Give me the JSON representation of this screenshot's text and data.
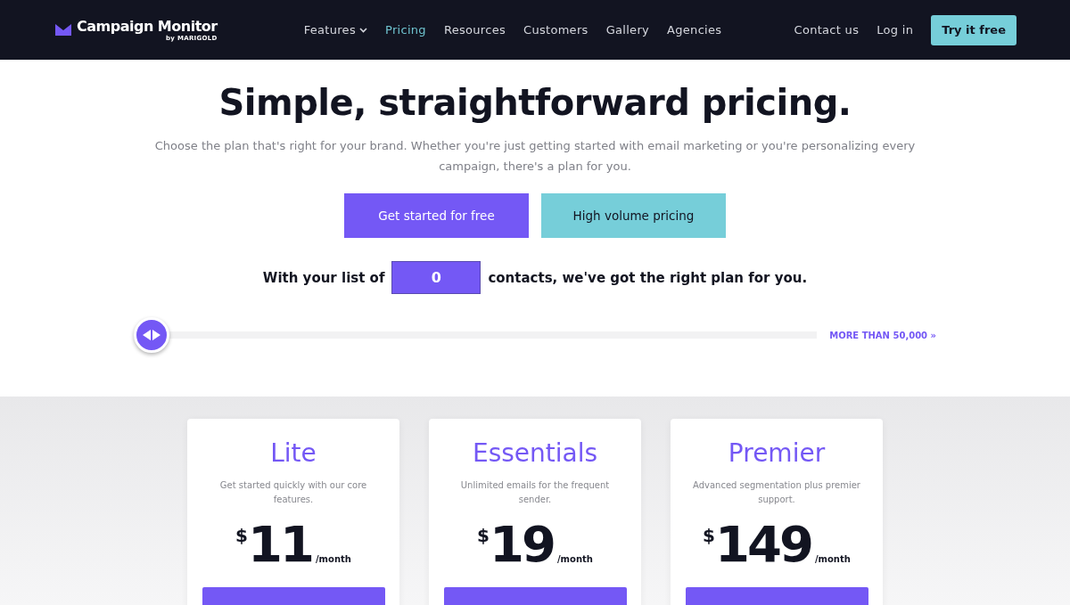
{
  "header": {
    "logo": {
      "name": "Campaign Monitor",
      "byline": "by MARIGOLD"
    },
    "nav": [
      {
        "label": "Features",
        "dropdown": true,
        "selected": false
      },
      {
        "label": "Pricing",
        "dropdown": false,
        "selected": true
      },
      {
        "label": "Resources",
        "dropdown": false,
        "selected": false
      },
      {
        "label": "Customers",
        "dropdown": false,
        "selected": false
      },
      {
        "label": "Gallery",
        "dropdown": false,
        "selected": false
      },
      {
        "label": "Agencies",
        "dropdown": false,
        "selected": false
      }
    ],
    "links": [
      "Contact us",
      "Log in"
    ],
    "cta": "Try it free"
  },
  "hero": {
    "title": "Simple, straightforward pricing.",
    "subtitle": "Choose the plan that's right for your brand. Whether you're just getting started with email marketing or you're personalizing every campaign, there's a plan for you.",
    "buttons": [
      {
        "label": "Get started for free",
        "kind": "primary"
      },
      {
        "label": "High volume pricing",
        "kind": "secondary"
      }
    ]
  },
  "contacts": {
    "before": "With your list of",
    "value": "0",
    "after": "contacts, we've got the right plan for you.",
    "slider": {
      "level": 0
    },
    "more_link": "MORE THAN 50,000 »"
  },
  "plans": [
    {
      "name": "Lite",
      "description": "Get started quickly with our core features.",
      "currency": "$",
      "price": "11",
      "period": "/month"
    },
    {
      "name": "Essentials",
      "description": "Unlimited emails for the frequent sender.",
      "currency": "$",
      "price": "19",
      "period": "/month"
    },
    {
      "name": "Premier",
      "description": "Advanced segmentation plus premier support.",
      "currency": "$",
      "price": "149",
      "period": "/month"
    }
  ]
}
